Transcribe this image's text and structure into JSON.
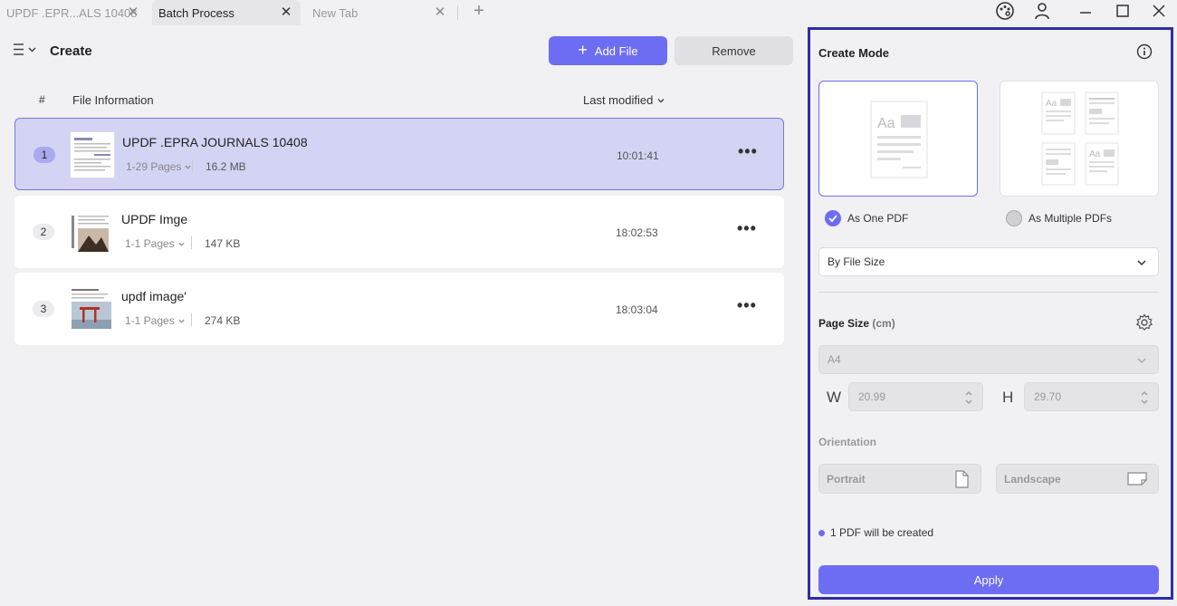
{
  "tabs": [
    {
      "label": "UPDF .EPR...ALS 10408",
      "active": false
    },
    {
      "label": "Batch Process",
      "active": true
    },
    {
      "label": "New Tab",
      "active": false
    }
  ],
  "toolbar": {
    "title": "Create",
    "add_file": "Add File",
    "remove": "Remove"
  },
  "table": {
    "col_num": "#",
    "col_info": "File Information",
    "col_modified": "Last modified",
    "rows": [
      {
        "num": "1",
        "name": "UPDF .EPRA JOURNALS 10408",
        "pages": "1-29 Pages",
        "size": "16.2 MB",
        "time": "10:01:41",
        "selected": true
      },
      {
        "num": "2",
        "name": "UPDF Imge",
        "pages": "1-1 Pages",
        "size": "147 KB",
        "time": "18:02:53",
        "selected": false
      },
      {
        "num": "3",
        "name": "updf image'",
        "pages": "1-1 Pages",
        "size": "274 KB",
        "time": "18:03:04",
        "selected": false
      }
    ]
  },
  "panel": {
    "title": "Create Mode",
    "as_one": "As One PDF",
    "as_multiple": "As Multiple PDFs",
    "mode_select": "By File Size",
    "page_size_label": "Page Size",
    "page_size_unit": "(cm)",
    "page_size_value": "A4",
    "w_label": "W",
    "w_value": "20.99",
    "h_label": "H",
    "h_value": "29.70",
    "orientation_label": "Orientation",
    "portrait": "Portrait",
    "landscape": "Landscape",
    "status": "1 PDF will be created",
    "apply": "Apply"
  },
  "colors": {
    "accent": "#6d6df4",
    "selected_row": "#d3d3f4",
    "panel_border": "#2d2da8"
  }
}
